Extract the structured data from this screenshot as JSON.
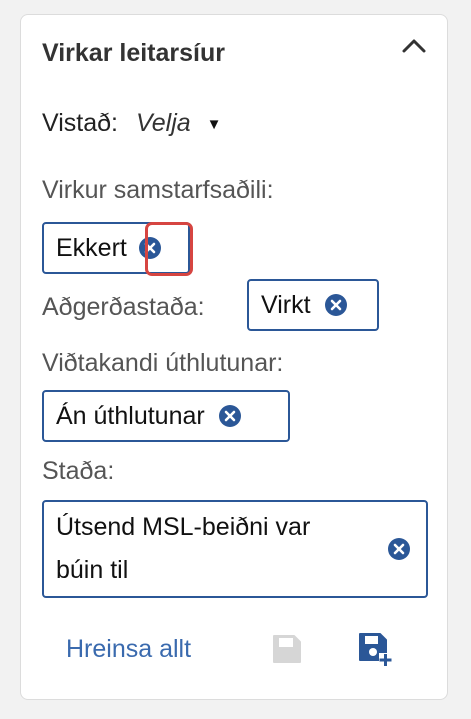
{
  "panel": {
    "title": "Virkar leitarsíur",
    "collapse_icon": "chevron-up-icon"
  },
  "saved": {
    "label": "Vistað:",
    "value": "Velja",
    "caret_icon": "caret-down-icon"
  },
  "filters": [
    {
      "label": "Virkur samstarfsaðili:",
      "chip": "Ekkert"
    },
    {
      "label": "Aðgerðastaða:",
      "chip": "Virkt"
    },
    {
      "label": "Viðtakandi úthlutunar:",
      "chip": "Án úthlutunar"
    },
    {
      "label": "Staða:",
      "chip_line1": "Útsend MSL-beiðni var",
      "chip_line2": "búin til"
    }
  ],
  "footer": {
    "clear_all": "Hreinsa allt",
    "save_icon": "save-icon",
    "save_new_icon": "save-new-icon"
  },
  "colors": {
    "accent": "#2b5797",
    "link": "#3a6aae",
    "highlight": "#d64541",
    "disabled": "#d6d6d6"
  }
}
